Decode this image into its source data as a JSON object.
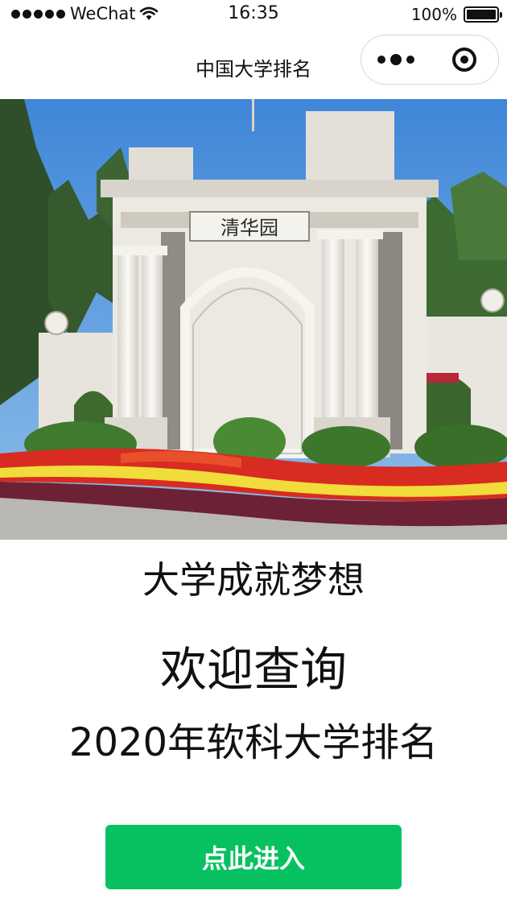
{
  "status_bar": {
    "carrier": "WeChat",
    "time": "16:35",
    "battery": "100%",
    "icons": [
      "signal-dots-icon",
      "wifi-icon",
      "battery-icon"
    ]
  },
  "nav": {
    "title": "中国大学排名",
    "capsule_icons": [
      "more-icon",
      "close-icon"
    ]
  },
  "hero": {
    "plaque_text": "清华园"
  },
  "content": {
    "line1": "大学成就梦想",
    "line2": "欢迎查询",
    "line3": "2020年软科大学排名"
  },
  "button": {
    "label": "点此进入",
    "color": "#07c160"
  }
}
